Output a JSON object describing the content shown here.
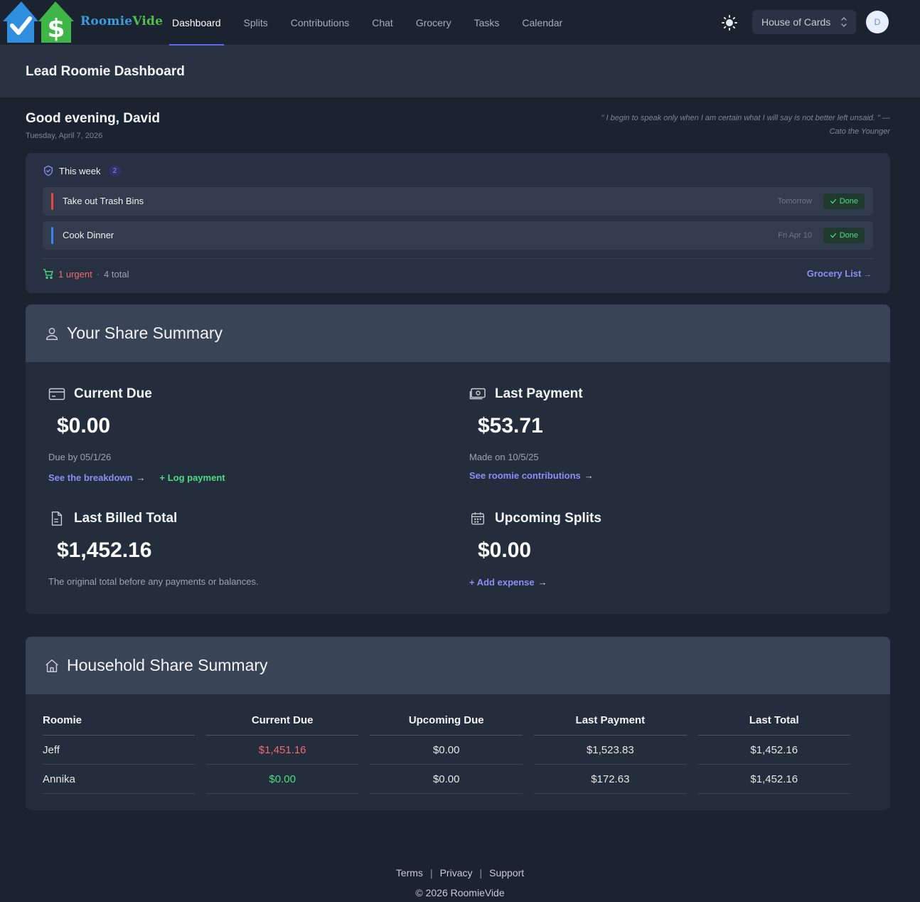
{
  "nav": {
    "brand_part1": "Roomie",
    "brand_part2": "Vide",
    "links": [
      "Dashboard",
      "Splits",
      "Contributions",
      "Chat",
      "Grocery",
      "Tasks",
      "Calendar"
    ],
    "active": "Dashboard",
    "house_select": "House of Cards",
    "avatar_initial": "D"
  },
  "header": {
    "title": "Lead Roomie Dashboard"
  },
  "greeting": {
    "text": "Good evening, David",
    "date": "Tuesday, April 7, 2026",
    "quote": "\" I begin to speak only when I am certain what I will say is not better left unsaid. \" — Cato the Younger"
  },
  "this_week": {
    "label": "This week",
    "count": "2",
    "tasks": [
      {
        "name": "Take out Trash Bins",
        "due": "Tomorrow",
        "action": "Done",
        "color": "#ef4444"
      },
      {
        "name": "Cook Dinner",
        "due": "Fri Apr 10",
        "action": "Done",
        "color": "#3b82f6"
      }
    ],
    "urgent": "1 urgent",
    "separator": "·",
    "total": "4 total",
    "grocery_link": "Grocery List",
    "grocery_arrow": "→"
  },
  "share_summary": {
    "title": "Your Share Summary",
    "current_due": {
      "label": "Current Due",
      "value": "$0.00",
      "sub": "Due by 05/1/26",
      "link": "See the breakdown",
      "log_link": "+ Log payment"
    },
    "last_payment": {
      "label": "Last Payment",
      "value": "$53.71",
      "sub": "Made on 10/5/25",
      "link": "See roomie contributions"
    },
    "last_billed": {
      "label": "Last Billed Total",
      "value": "$1,452.16",
      "sub": "The original total before any payments or balances."
    },
    "upcoming": {
      "label": "Upcoming Splits",
      "value": "$0.00",
      "link": "+ Add expense"
    },
    "arrow": "→"
  },
  "household": {
    "title": "Household Share Summary",
    "columns": [
      "Roomie",
      "Current Due",
      "Upcoming Due",
      "Last Payment",
      "Last Total"
    ],
    "rows": [
      {
        "name": "Jeff",
        "current_due": "$1,451.16",
        "upcoming_due": "$0.00",
        "last_payment": "$1,523.83",
        "last_total": "$1,452.16"
      },
      {
        "name": "Annika",
        "current_due": "$0.00",
        "upcoming_due": "$0.00",
        "last_payment": "$172.63",
        "last_total": "$1,452.16"
      }
    ]
  },
  "footer": {
    "links": [
      "Terms",
      "Privacy",
      "Support"
    ],
    "separator": "|",
    "copyright": "© 2026 RoomieVide"
  },
  "colors": {
    "accent": "#6366f1",
    "link": "#8b8ff6",
    "danger": "#f26b6b",
    "success": "#4ade80",
    "background": "#1b2230"
  }
}
